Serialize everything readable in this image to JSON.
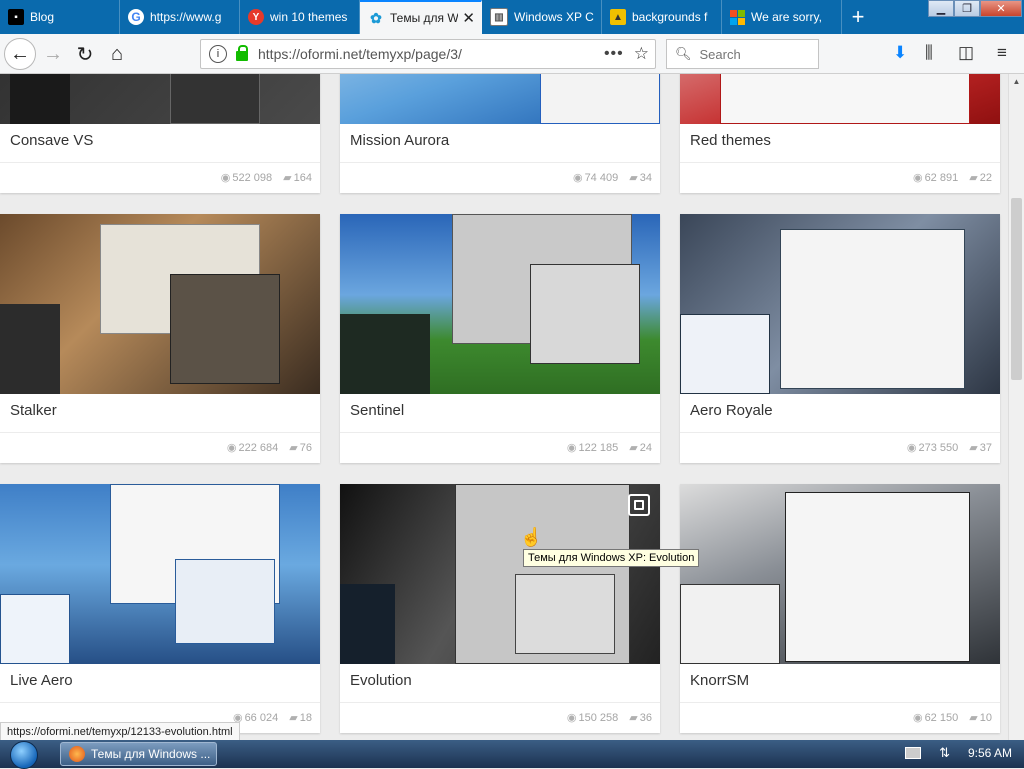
{
  "tabs": [
    {
      "title": "Blog",
      "icon": "blog-icon",
      "active": false
    },
    {
      "title": "https://www.g",
      "icon": "google-icon",
      "active": false
    },
    {
      "title": "win 10 themes",
      "icon": "yandex-icon",
      "active": false
    },
    {
      "title": "Темы для W",
      "icon": "oformi-icon",
      "active": true
    },
    {
      "title": "Windows XP C",
      "icon": "ms-icon",
      "active": false
    },
    {
      "title": "backgrounds f",
      "icon": "image-icon",
      "active": false
    },
    {
      "title": "We are sorry,",
      "icon": "windows-icon",
      "active": false
    }
  ],
  "nav": {
    "url": "https://oformi.net/temyxp/page/3/",
    "search_placeholder": "Search"
  },
  "cards": [
    {
      "title": "Consave VS",
      "views": "522 098",
      "comments": "164"
    },
    {
      "title": "Mission Aurora",
      "views": "74 409",
      "comments": "34"
    },
    {
      "title": "Red themes",
      "views": "62 891",
      "comments": "22"
    },
    {
      "title": "Stalker",
      "views": "222 684",
      "comments": "76"
    },
    {
      "title": "Sentinel",
      "views": "122 185",
      "comments": "24"
    },
    {
      "title": "Aero Royale",
      "views": "273 550",
      "comments": "37"
    },
    {
      "title": "Live Aero",
      "views": "66 024",
      "comments": "18"
    },
    {
      "title": "Evolution",
      "views": "150 258",
      "comments": "36"
    },
    {
      "title": "KnorrSM",
      "views": "62 150",
      "comments": "10"
    }
  ],
  "tooltip": "Темы для Windows XP: Evolution",
  "status_url": "https://oformi.net/temyxp/12133-evolution.html",
  "taskbar": {
    "window_title": "Темы для Windows ...",
    "clock": "9:56 AM"
  }
}
